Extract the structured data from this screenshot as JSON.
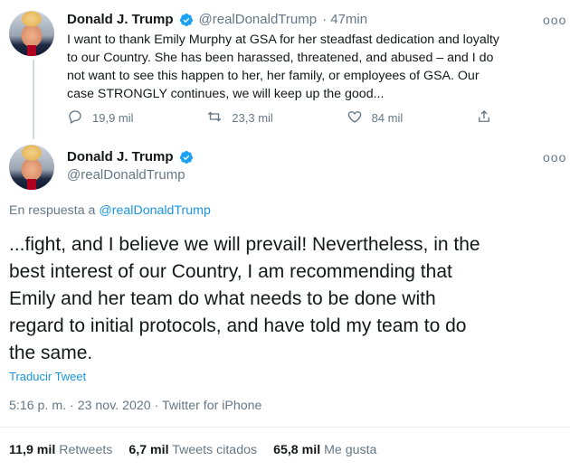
{
  "tweet1": {
    "name": "Donald J. Trump",
    "handle": "@realDonaldTrump",
    "time": "· 47min",
    "more": "ooo",
    "lines": [
      "I want to thank Emily Murphy at GSA for her steadfast dedication and loyalty",
      "to our Country. She has been harassed, threatened, and abused – and I do",
      "not want to see this happen to her, her family, or employees of GSA. Our",
      "case STRONGLY continues, we will keep up the good..."
    ],
    "replies": "19,9 mil",
    "retweets": "23,3 mil",
    "likes": "84 mil"
  },
  "tweet2": {
    "name": "Donald J. Trump",
    "handle": "@realDonaldTrump",
    "more": "ooo",
    "reply_prefix": "En respuesta a",
    "reply_to": "@realDonaldTrump",
    "lines": [
      "...fight, and I believe we will prevail! Nevertheless, in the",
      "best interest of our Country, I am recommending that",
      "Emily and her team do what needs to be done with",
      "regard to initial protocols, and have told my team to do",
      "the same."
    ],
    "translate": "Traducir Tweet",
    "meta": "5:16 p. m. · 23 nov. 2020 · Twitter for iPhone",
    "stats": {
      "retweets_value": "11,9 mil",
      "retweets_label": "Retweets",
      "quotes_value": "6,7 mil",
      "quotes_label": "Tweets citados",
      "likes_value": "65,8 mil",
      "likes_label": "Me gusta"
    }
  },
  "colors": {
    "accent": "#1b95e0",
    "muted": "#657786",
    "text": "#14171a"
  },
  "icons": [
    "verified-badge-icon",
    "reply-icon",
    "retweet-icon",
    "like-icon",
    "share-icon",
    "more-icon"
  ]
}
